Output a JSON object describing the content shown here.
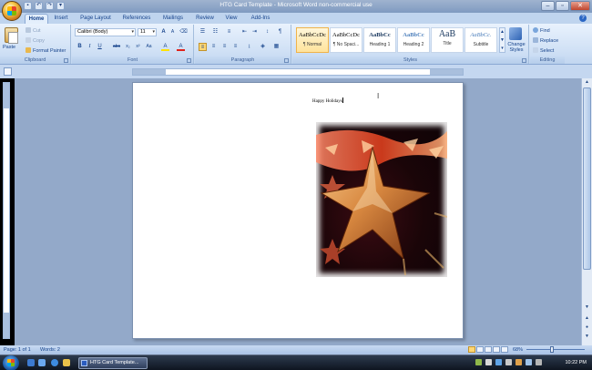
{
  "window": {
    "title": "HTG Card Template - Microsoft Word non-commercial use",
    "quick_access": [
      "save-icon",
      "undo-icon",
      "redo-icon",
      "customize-qat-icon"
    ],
    "controls": [
      "–",
      "▫",
      "✕"
    ]
  },
  "tabs": [
    "Home",
    "Insert",
    "Page Layout",
    "References",
    "Mailings",
    "Review",
    "View",
    "Add-Ins"
  ],
  "active_tab": "Home",
  "ribbon": {
    "clipboard": {
      "paste": "Paste",
      "cut": "Cut",
      "copy": "Copy",
      "format_painter": "Format Painter",
      "label": "Clipboard"
    },
    "font": {
      "family": "Calibri (Body)",
      "size": "11",
      "label": "Font",
      "buttons": [
        "B",
        "I",
        "U",
        "abc",
        "x₂",
        "x²",
        "Aa",
        "A",
        "A"
      ],
      "grow": "A",
      "shrink": "A"
    },
    "paragraph": {
      "label": "Paragraph",
      "pilcrow": "¶"
    },
    "styles": {
      "label": "Styles",
      "items": [
        {
          "sample": "AaBbCcDc",
          "name": "¶ Normal"
        },
        {
          "sample": "AaBbCcDc",
          "name": "¶ No Spaci..."
        },
        {
          "sample": "AaBbCc",
          "name": "Heading 1"
        },
        {
          "sample": "AaBbCc",
          "name": "Heading 2"
        },
        {
          "sample": "AaB",
          "name": "Title"
        },
        {
          "sample": "AaBbCc.",
          "name": "Subtitle"
        }
      ],
      "change_styles": "Change Styles"
    },
    "editing": {
      "label": "Editing",
      "find": "Find",
      "replace": "Replace",
      "select": "Select"
    }
  },
  "document": {
    "text": "Happy Holidays",
    "image": "christmas-star-ornament-photo"
  },
  "status": {
    "page": "Page: 1 of 1",
    "words": "Words: 2",
    "zoom": "68%",
    "zoom_fraction": 0.68
  },
  "taskbar": {
    "task": "HTG Card Template...",
    "clock": "10:22 PM"
  },
  "colors": {
    "ribbon_bg": "#cfe0f5",
    "doc_bg": "#93a9c9",
    "accent": "#15428b",
    "style_selected": "#ffe39b"
  }
}
